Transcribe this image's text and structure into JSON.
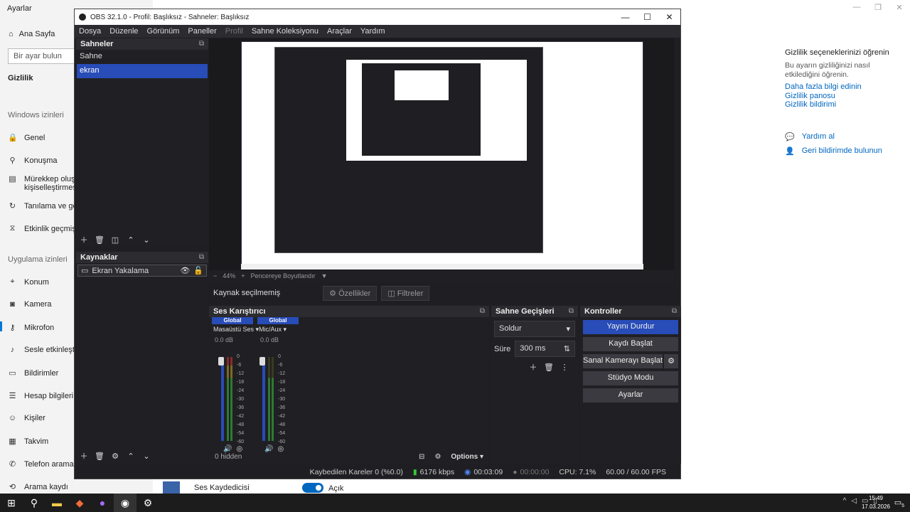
{
  "settings": {
    "title": "Ayarlar",
    "home": "Ana Sayfa",
    "search_placeholder": "Bir ayar bulun",
    "active_section": "Gizlilik",
    "windows_permissions": "Windows izinleri",
    "windows_items": [
      {
        "label": "Genel",
        "icon": "lock-icon"
      },
      {
        "label": "Konuşma",
        "icon": "speech-icon"
      },
      {
        "label": "Mürekkep oluştur",
        "label2": "kişiselleştirmesi",
        "icon": "ink-icon"
      },
      {
        "label": "Tanılama ve geri b",
        "icon": "diagnostic-icon"
      },
      {
        "label": "Etkinlik geçmişi",
        "icon": "history-icon"
      }
    ],
    "app_permissions": "Uygulama izinleri",
    "app_items": [
      {
        "label": "Konum",
        "icon": "location-icon"
      },
      {
        "label": "Kamera",
        "icon": "camera-icon"
      },
      {
        "label": "Mikrofon",
        "icon": "microphone-icon"
      },
      {
        "label": "Sesle etkinleştirme",
        "icon": "voice-icon"
      },
      {
        "label": "Bildirimler",
        "icon": "notification-icon"
      },
      {
        "label": "Hesap bilgileri",
        "icon": "account-icon"
      },
      {
        "label": "Kişiler",
        "icon": "contacts-icon"
      },
      {
        "label": "Takvim",
        "icon": "calendar-icon"
      },
      {
        "label": "Telefon aramaları",
        "icon": "phone-icon"
      },
      {
        "label": "Arama kaydı",
        "icon": "call-history-icon"
      }
    ],
    "right_panel": {
      "title": "Gizlilik seçeneklerinizi öğrenin",
      "desc": "Bu ayarın gizliliğinizi nasıl etkilediğini öğrenin.",
      "links": [
        "Daha fazla bilgi edinin",
        "Gizlilik panosu",
        "Gizlilik bildirimi"
      ],
      "help": "Yardım al",
      "feedback": "Geri bildirimde bulunun"
    },
    "recorder_app": "Ses Kaydedicisi",
    "recorder_state": "Açık"
  },
  "obs": {
    "title": "OBS 32.1.0 - Profil: Başlıksız - Sahneler: Başlıksız",
    "menu": [
      "Dosya",
      "Düzenle",
      "Görünüm",
      "Paneller",
      "Profil",
      "Sahne Koleksiyonu",
      "Araçlar",
      "Yardım"
    ],
    "scenes_title": "Sahneler",
    "scenes": [
      "Sahne",
      "ekran"
    ],
    "sources_title": "Kaynaklar",
    "sources": [
      "Ekran Yakalama"
    ],
    "zoom": "44%",
    "fit_label": "Pencereye Boyutlandır",
    "no_source": "Kaynak seçilmemiş",
    "properties": "Özellikler",
    "filters": "Filtreler",
    "mixer_title": "Ses Karıştırıcı",
    "mixer_channels": [
      {
        "global": "Global",
        "name": "Masaüstü Ses",
        "db": "0.0 dB"
      },
      {
        "global": "Global",
        "name": "Mic/Aux",
        "db": "0.0 dB"
      }
    ],
    "meter_scale": [
      "0",
      "-6",
      "-12",
      "-18",
      "-24",
      "-30",
      "-36",
      "-42",
      "-48",
      "-54",
      "-60"
    ],
    "hidden": "0 hidden",
    "options": "Options",
    "transitions_title": "Sahne Geçişleri",
    "transition": "Soldur",
    "duration_label": "Süre",
    "duration": "300 ms",
    "controls_title": "Kontroller",
    "controls": [
      "Yayını Durdur",
      "Kaydı Başlat",
      "Sanal Kamerayı Başlat",
      "Stüdyo Modu",
      "Ayarlar"
    ],
    "status": {
      "dropped": "Kaybedilen Kareler 0 (%0.0)",
      "bitrate": "6176 kbps",
      "stream_time": "00:03:09",
      "rec_time": "00:00:00",
      "cpu": "CPU: 7.1%",
      "fps": "60.00 / 60.00 FPS"
    }
  },
  "taskbar": {
    "time": "15:49",
    "date": "17.03.2026",
    "notif_count": "5"
  }
}
